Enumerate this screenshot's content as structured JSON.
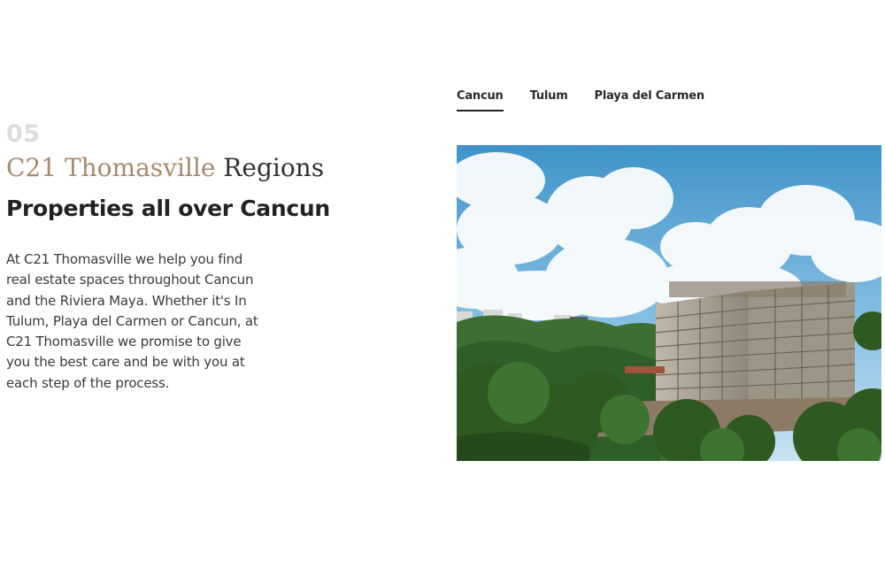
{
  "section": {
    "number": "05",
    "brand": "C21 Thomasville",
    "title_rest": "Regions",
    "headline": "Properties all over Cancun",
    "description": "At C21 Thomasville we help you find real estate spaces throughout Cancun and the Riviera Maya. Whether it's In Tulum, Playa del Carmen or Cancun, at C21 Thomasville we promise to give you the best care and be with you at each step of the process."
  },
  "tabs": [
    {
      "label": "Cancun",
      "active": true
    },
    {
      "label": "Tulum",
      "active": false
    },
    {
      "label": "Playa del Carmen",
      "active": false
    }
  ],
  "colors": {
    "brand_accent": "#a68a6c",
    "number": "#dcdcdc",
    "text_dark": "#222222"
  }
}
